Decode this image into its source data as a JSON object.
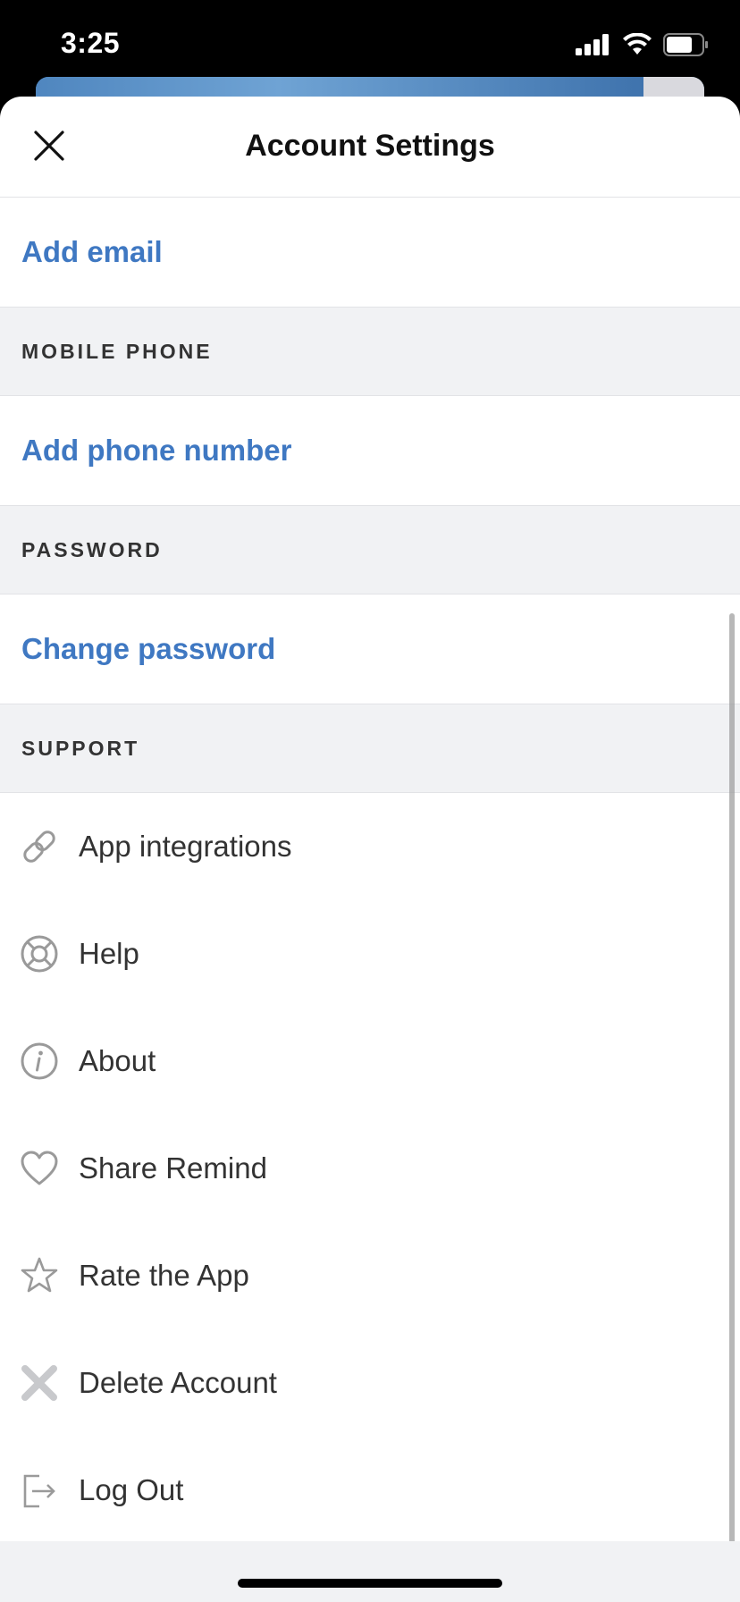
{
  "status": {
    "time": "3:25"
  },
  "header": {
    "title": "Account Settings"
  },
  "email": {
    "label": "Add email"
  },
  "mobile": {
    "section": "MOBILE PHONE",
    "label": "Add phone number"
  },
  "password": {
    "section": "PASSWORD",
    "label": "Change password"
  },
  "support": {
    "section": "SUPPORT",
    "items": [
      {
        "label": "App integrations",
        "icon": "link-icon"
      },
      {
        "label": "Help",
        "icon": "lifebuoy-icon"
      },
      {
        "label": "About",
        "icon": "info-icon"
      },
      {
        "label": "Share Remind",
        "icon": "heart-icon"
      },
      {
        "label": "Rate the App",
        "icon": "star-icon"
      },
      {
        "label": "Delete Account",
        "icon": "x-icon"
      },
      {
        "label": "Log Out",
        "icon": "logout-icon"
      }
    ]
  },
  "colors": {
    "link": "#3f78c2",
    "section_bg": "#f1f2f4",
    "icon": "#9a9a9a"
  }
}
